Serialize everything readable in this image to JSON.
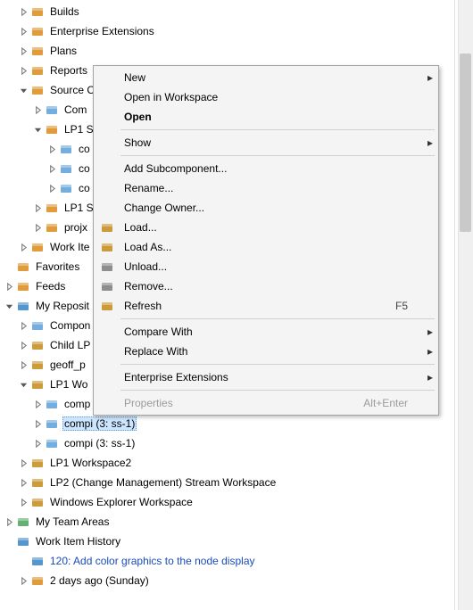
{
  "tree": {
    "items": [
      {
        "indent": 1,
        "twisty": "closed",
        "icon": "builds-icon",
        "iconColor": "#d98a1a",
        "label": "Builds"
      },
      {
        "indent": 1,
        "twisty": "closed",
        "icon": "ext-icon",
        "iconColor": "#d98a1a",
        "label": "Enterprise Extensions"
      },
      {
        "indent": 1,
        "twisty": "closed",
        "icon": "plans-icon",
        "iconColor": "#d98a1a",
        "label": "Plans"
      },
      {
        "indent": 1,
        "twisty": "closed",
        "icon": "reports-icon",
        "iconColor": "#d98a1a",
        "label": "Reports"
      },
      {
        "indent": 1,
        "twisty": "open",
        "icon": "source-icon",
        "iconColor": "#d98a1a",
        "label": "Source C"
      },
      {
        "indent": 2,
        "twisty": "closed",
        "icon": "comp-icon",
        "iconColor": "#5aa0d8",
        "label": "Com"
      },
      {
        "indent": 2,
        "twisty": "open",
        "icon": "stream-icon",
        "iconColor": "#d98a1a",
        "label": "LP1 S"
      },
      {
        "indent": 3,
        "twisty": "closed",
        "icon": "comp-icon",
        "iconColor": "#5aa0d8",
        "label": "co"
      },
      {
        "indent": 3,
        "twisty": "closed",
        "icon": "comp-icon",
        "iconColor": "#5aa0d8",
        "label": "co"
      },
      {
        "indent": 3,
        "twisty": "closed",
        "icon": "comp-icon",
        "iconColor": "#5aa0d8",
        "label": "co"
      },
      {
        "indent": 2,
        "twisty": "closed",
        "icon": "stream-icon",
        "iconColor": "#d98a1a",
        "label": "LP1 S"
      },
      {
        "indent": 2,
        "twisty": "closed",
        "icon": "stream-icon",
        "iconColor": "#d98a1a",
        "label": "projx"
      },
      {
        "indent": 1,
        "twisty": "closed",
        "icon": "workitems-icon",
        "iconColor": "#d98a1a",
        "label": "Work Ite"
      },
      {
        "indent": 0,
        "twisty": "none",
        "icon": "favorites-icon",
        "iconColor": "#d98a1a",
        "label": "Favorites"
      },
      {
        "indent": 0,
        "twisty": "closed",
        "icon": "feeds-icon",
        "iconColor": "#d98a1a",
        "label": "Feeds"
      },
      {
        "indent": 0,
        "twisty": "open",
        "icon": "repo-icon",
        "iconColor": "#3a82c4",
        "label": "My Reposit"
      },
      {
        "indent": 1,
        "twisty": "closed",
        "icon": "comp-icon",
        "iconColor": "#5aa0d8",
        "label": "Compon"
      },
      {
        "indent": 1,
        "twisty": "closed",
        "icon": "ws-icon",
        "iconColor": "#c28a1a",
        "label": "Child LP"
      },
      {
        "indent": 1,
        "twisty": "closed",
        "icon": "ws-icon",
        "iconColor": "#c28a1a",
        "label": "geoff_p"
      },
      {
        "indent": 1,
        "twisty": "open",
        "icon": "ws-icon",
        "iconColor": "#c28a1a",
        "label": "LP1 Wo"
      },
      {
        "indent": 2,
        "twisty": "closed",
        "icon": "comp-icon",
        "iconColor": "#5aa0d8",
        "label": "comp"
      },
      {
        "indent": 2,
        "twisty": "closed",
        "icon": "comp-icon",
        "iconColor": "#5aa0d8",
        "label": "compi (3: ss-1)",
        "selected": true
      },
      {
        "indent": 2,
        "twisty": "closed",
        "icon": "comp-icon",
        "iconColor": "#5aa0d8",
        "label": "compi (3: ss-1)"
      },
      {
        "indent": 1,
        "twisty": "closed",
        "icon": "ws-icon",
        "iconColor": "#c28a1a",
        "label": "LP1 Workspace2"
      },
      {
        "indent": 1,
        "twisty": "closed",
        "icon": "ws-icon",
        "iconColor": "#c28a1a",
        "label": "LP2 (Change Management) Stream Workspace"
      },
      {
        "indent": 1,
        "twisty": "closed",
        "icon": "ws-icon",
        "iconColor": "#c28a1a",
        "label": "Windows Explorer Workspace"
      },
      {
        "indent": 0,
        "twisty": "closed",
        "icon": "team-icon",
        "iconColor": "#49a35a",
        "label": "My Team Areas"
      },
      {
        "indent": 0,
        "twisty": "none",
        "icon": "history-icon",
        "iconColor": "#3a82c4",
        "label": "Work Item History"
      },
      {
        "indent": 1,
        "twisty": "none",
        "icon": "wi-icon",
        "iconColor": "#3a82c4",
        "label": "120: Add color graphics to the node display",
        "link": true
      },
      {
        "indent": 1,
        "twisty": "closed",
        "icon": "time-icon",
        "iconColor": "#d98a1a",
        "label": "2 days ago (Sunday)"
      }
    ]
  },
  "context_menu": {
    "items": [
      {
        "kind": "item",
        "label": "New",
        "sub": true
      },
      {
        "kind": "item",
        "label": "Open in Workspace"
      },
      {
        "kind": "item",
        "label": "Open",
        "bold": true
      },
      {
        "kind": "sep"
      },
      {
        "kind": "item",
        "label": "Show",
        "sub": true
      },
      {
        "kind": "sep"
      },
      {
        "kind": "item",
        "label": "Add Subcomponent..."
      },
      {
        "kind": "item",
        "label": "Rename..."
      },
      {
        "kind": "item",
        "label": "Change Owner..."
      },
      {
        "kind": "item",
        "label": "Load...",
        "icon": "load-icon",
        "iconColor": "#c28a1a"
      },
      {
        "kind": "item",
        "label": "Load As...",
        "icon": "loadas-icon",
        "iconColor": "#c28a1a"
      },
      {
        "kind": "item",
        "label": "Unload...",
        "icon": "unload-icon",
        "iconColor": "#7a7a7a"
      },
      {
        "kind": "item",
        "label": "Remove...",
        "icon": "remove-icon",
        "iconColor": "#7a7a7a"
      },
      {
        "kind": "item",
        "label": "Refresh",
        "icon": "refresh-icon",
        "iconColor": "#c28a1a",
        "accel": "F5"
      },
      {
        "kind": "sep"
      },
      {
        "kind": "item",
        "label": "Compare With",
        "sub": true
      },
      {
        "kind": "item",
        "label": "Replace With",
        "sub": true
      },
      {
        "kind": "sep"
      },
      {
        "kind": "item",
        "label": "Enterprise Extensions",
        "sub": true
      },
      {
        "kind": "sep"
      },
      {
        "kind": "item",
        "label": "Properties",
        "accel": "Alt+Enter",
        "disabled": true
      }
    ]
  }
}
